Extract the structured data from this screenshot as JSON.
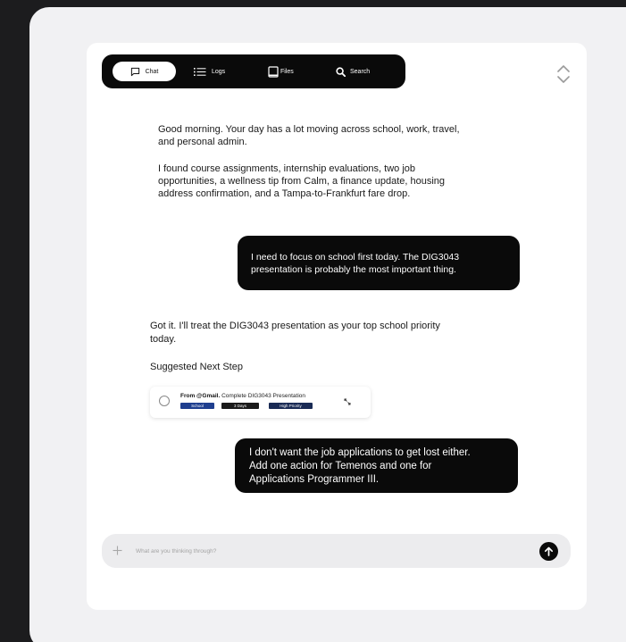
{
  "nav": {
    "tabs": [
      {
        "label": "Chat",
        "icon": "chat-icon",
        "active": true
      },
      {
        "label": "Logs",
        "icon": "list-icon",
        "active": false
      },
      {
        "label": "Files",
        "icon": "file-icon",
        "active": false
      },
      {
        "label": "Search",
        "icon": "search-icon",
        "active": false
      }
    ]
  },
  "messages": {
    "assistant_1": {
      "line1": "Good morning. Your day has a lot moving across school, work, travel,",
      "line2": "and personal admin.",
      "line3": "I found course assignments, internship evaluations, two job",
      "line4": "opportunities, a wellness tip from Calm, a finance update, housing",
      "line5": "address confirmation, and a Tampa-to-Frankfurt fare drop."
    },
    "user_1": {
      "line1": "I need to focus on school first today. The DIG3043",
      "line2": "presentation is probably the most important thing."
    },
    "assistant_2": {
      "line1": "Got it. I'll treat the DIG3043 presentation as your top school priority",
      "line2": "today.",
      "next_step_label": "Suggested Next Step"
    },
    "user_2": {
      "line1": "I don't want the job applications to get lost either.",
      "line2": "Add one action for Temenos and one for",
      "line3": "Applications Programmer III."
    }
  },
  "task": {
    "source": "From @Gmail.",
    "title": "Complete DIG3043 Presentation",
    "tags": [
      {
        "label": "School",
        "color": "#1f3f8f"
      },
      {
        "label": "3 Days",
        "color": "#1a1a1a"
      },
      {
        "label": "High Priority",
        "color": "#1a2b55"
      }
    ]
  },
  "composer": {
    "placeholder": "What are you thinking through?",
    "icon": "plus-icon",
    "send_icon": "arrow-up-icon"
  },
  "colors": {
    "page_bg": "#1c1c1e",
    "panel_bg": "#f1f1f3",
    "nav_bg": "#0a0a0a",
    "bubble_bg": "#0a0a0a",
    "input_bg": "#ececee"
  }
}
